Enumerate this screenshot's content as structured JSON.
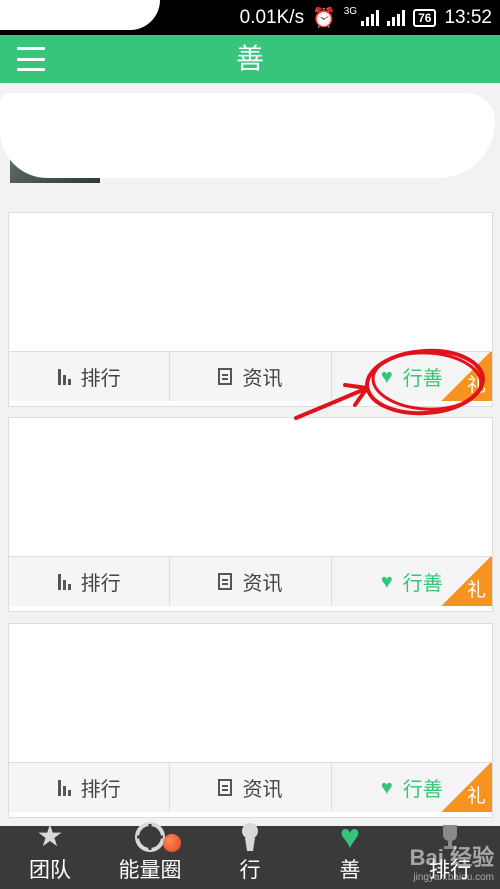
{
  "status_bar": {
    "speed": "0.01K/s",
    "network": "3G",
    "battery": "76",
    "time": "13:52"
  },
  "header": {
    "title": "善",
    "menu_icon": "menu-icon"
  },
  "cards": [
    {
      "actions": {
        "rank": "排行",
        "news": "资讯",
        "charity": "行善",
        "gift": "礼"
      }
    },
    {
      "actions": {
        "rank": "排行",
        "news": "资讯",
        "charity": "行善",
        "gift": "礼"
      }
    },
    {
      "actions": {
        "rank": "排行",
        "news": "资讯",
        "charity": "行善",
        "gift": "礼"
      }
    }
  ],
  "bottom_nav": {
    "items": [
      {
        "label": "团队",
        "icon": "star-icon"
      },
      {
        "label": "能量圈",
        "icon": "aperture-icon"
      },
      {
        "label": "行",
        "icon": "runner-icon"
      },
      {
        "label": "善",
        "icon": "heart-icon"
      },
      {
        "label": "排行",
        "icon": "trophy-icon"
      }
    ]
  },
  "watermark": {
    "brand": "Bai 经验",
    "site": "jingyan.baidu.com"
  },
  "colors": {
    "accent": "#36c57b",
    "gift": "#f7931e",
    "nav_bg": "#3a3a3a",
    "annotation": "#e0121c"
  }
}
